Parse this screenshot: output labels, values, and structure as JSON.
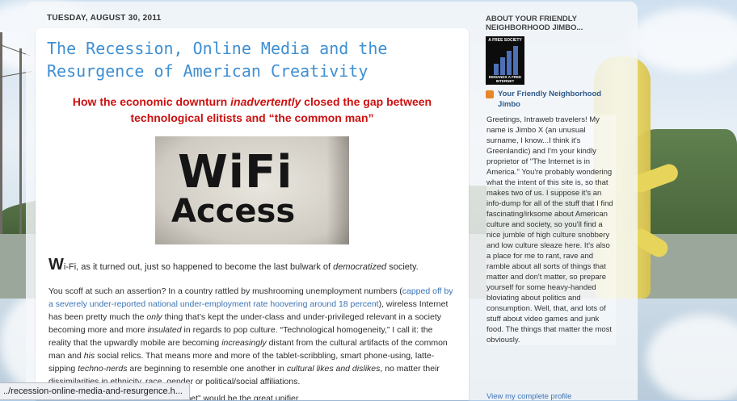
{
  "post": {
    "date": "TUESDAY, AUGUST 30, 2011",
    "title": "The Recession, Online Media and the Resurgence of American Creativity",
    "subtitle_a": "How the economic downturn ",
    "subtitle_em": "inadvertently",
    "subtitle_b": " closed the gap between technological elitists and “the common man”",
    "image_line1": "WiFi",
    "image_line2": "Access",
    "p1_drop": "W",
    "p1_a": "i-Fi, as it turned out, just so happened to become the last bulwark of ",
    "p1_em": "democratized",
    "p1_b": " society.",
    "p2_a": "You scoff at such an assertion? In a country rattled by mushrooming unemployment numbers (",
    "p2_link": "capped off by a severely under-reported national under-employment rate hoovering around 18 percent",
    "p2_b": "), wireless Internet has been pretty much the ",
    "p2_only": "only",
    "p2_c": " thing that’s kept the under-class and under-privileged relevant in a society becoming more and more ",
    "p2_insulated": "insulated",
    "p2_d": " in regards to pop culture. “Technological homogeneity,” I call it: the reality that the upwardly mobile are becoming ",
    "p2_increasingly": "increasingly",
    "p2_e": " distant from the cultural artifacts of the common man and ",
    "p2_his": "his",
    "p2_f": " social relics. That means more and more of the tablet-scribbling, smart phone-using, latte-sipping ",
    "p2_techno": "techno-nerds",
    "p2_g": " are beginning to resemble one another in ",
    "p2_cultural": "cultural likes and dislikes",
    "p2_h": ", no matter their dissimilarities in ethnicity, race, gender or political/social affiliations.",
    "p3": "two decades has been that the “Intranet” would be the great unifier"
  },
  "sidebar": {
    "heading": "ABOUT YOUR FRIENDLY NEIGHBORHOOD JIMBO...",
    "logo_top": "A FREE SOCIETY",
    "logo_bottom": "DEMANDS A FREE INTERNET",
    "profile_name": "Your Friendly Neighborhood Jimbo",
    "bio": "Greetings, Intraweb travelers! My name is Jimbo X (an unusual surname, I know...I think it's Greenlandic) and I'm your kindly proprietor of \"The Internet is in America.\" You're probably wondering what the intent of this site is, so that makes two of us. I suppose it's an info-dump for all of the stuff that I find fascinating/irksome about American culture and society, so you'll find a nice jumble of high culture snobbery and low culture sleaze here. It's also a place for me to rant, rave and ramble about all sorts of things that matter and don't matter, so prepare yourself for some heavy-handed bloviating about politics and consumption. Well, that, and lots of stuff about video games and junk food. The things that matter the most obviously.",
    "view_profile": "View my complete profile"
  },
  "status_bar": {
    "url": "../recession-online-media-and-resurgence.h..."
  },
  "colors": {
    "title": "#3f8fd2",
    "subtitle": "#cc1111",
    "link": "#3b74b5"
  },
  "icons": [
    "blogger-profile-icon",
    "free-internet-logo"
  ]
}
